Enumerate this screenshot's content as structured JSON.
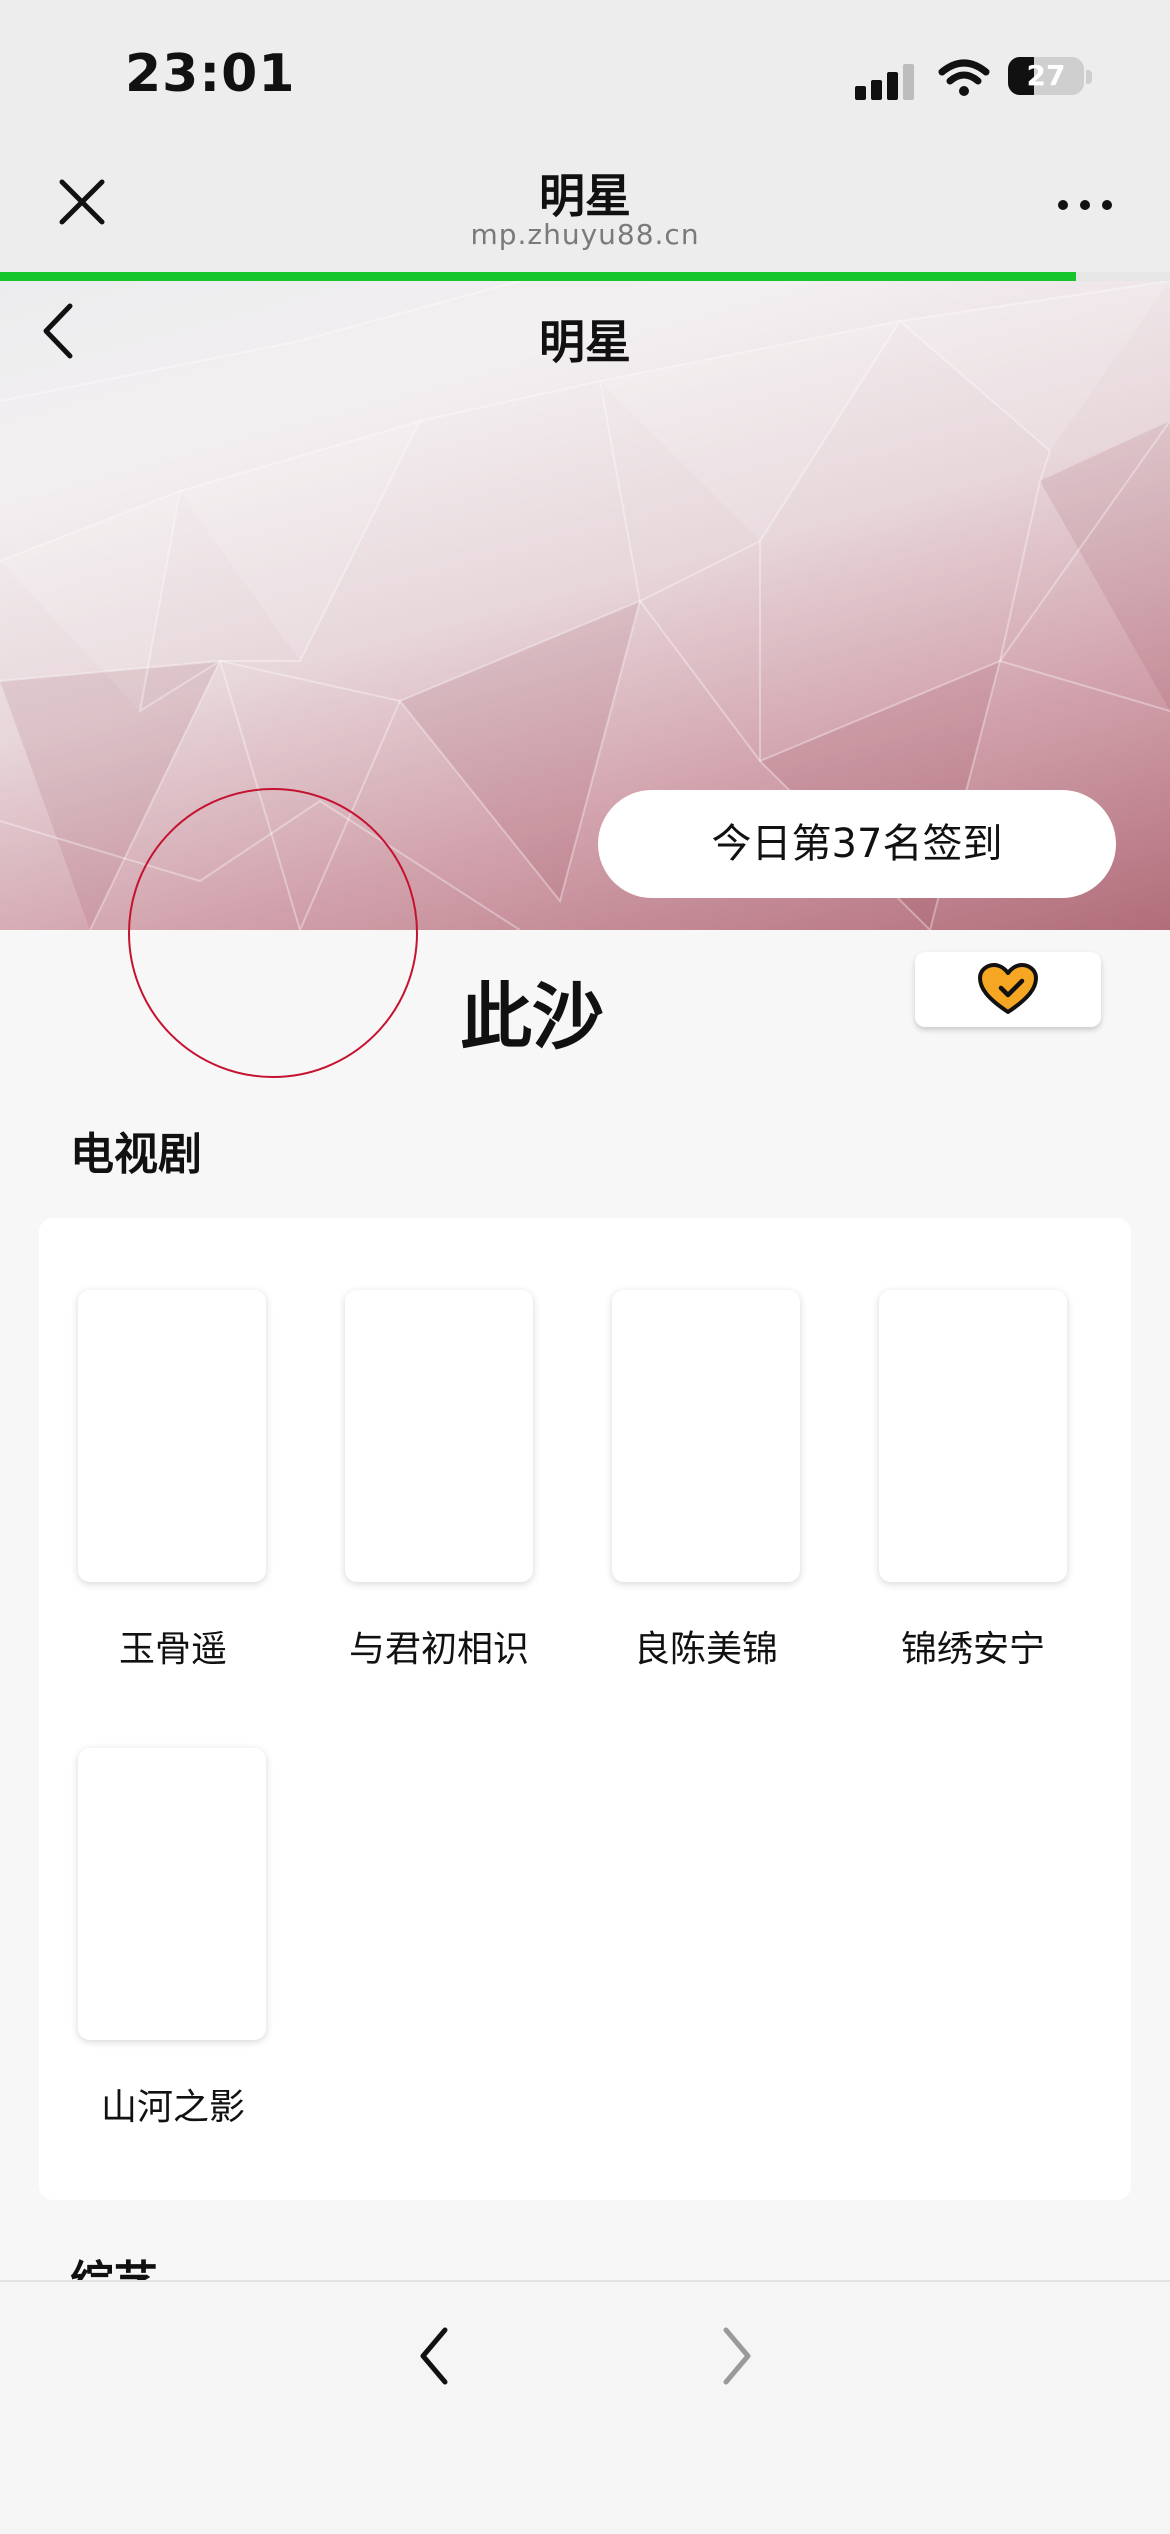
{
  "status_bar": {
    "time": "23:01",
    "battery_level": "27",
    "icons": [
      "cellular-signal-icon",
      "wifi-icon",
      "battery-icon"
    ]
  },
  "browser": {
    "title": "明星",
    "url": "mp.zhuyu88.cn",
    "load_progress_percent": 92,
    "accent_color": "#16c52a",
    "icons": [
      "close-icon",
      "more-icon"
    ]
  },
  "page": {
    "title": "明星",
    "checkin_text": "今日第37名签到",
    "star_name": "此沙",
    "follow_icon": "heart-check-icon",
    "accent_color": "#f5a623"
  },
  "sections": {
    "tv_title": "电视剧",
    "variety_title": "综艺",
    "tv_shows": [
      {
        "title": "玉骨遥"
      },
      {
        "title": "与君初相识"
      },
      {
        "title": "良陈美锦"
      },
      {
        "title": "锦绣安宁"
      },
      {
        "title": "山河之影"
      }
    ]
  },
  "toolbar": {
    "icons": [
      "chevron-left-icon",
      "chevron-right-icon"
    ]
  }
}
